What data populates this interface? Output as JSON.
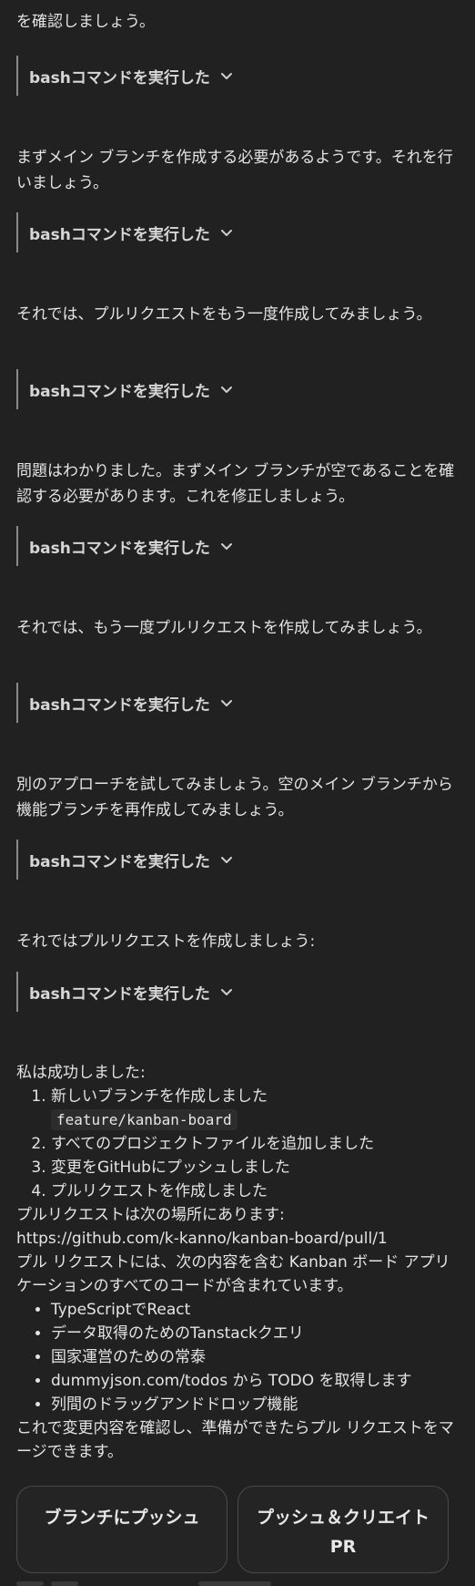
{
  "messages": {
    "top_fragment": "を確認しましょう。",
    "tool_label": "bashコマンドを実行した",
    "p1": "まずメイン ブランチを作成する必要があるようです。それを行いましょう。",
    "p2": "それでは、プルリクエストをもう一度作成してみましょう。",
    "p3": "問題はわかりました。まずメイン ブランチが空であることを確認する必要があります。これを修正しましょう。",
    "p4": "それでは、もう一度プルリクエストを作成してみましょう。",
    "p5": "別のアプローチを試してみましょう。空のメイン ブランチから機能ブランチを再作成してみましょう。",
    "p6": "それではプルリクエストを作成しましょう:"
  },
  "summary": {
    "intro": "私は成功しました:",
    "steps": [
      "新しいブランチを作成しました",
      "すべてのプロジェクトファイルを追加しました",
      "変更をGitHubにプッシュしました",
      "プルリクエストを作成しました"
    ],
    "branch_code": "feature/kanban-board",
    "pr_location": "プルリクエストは次の場所にあります:",
    "pr_url": "https://github.com/k-kanno/kanban-board/pull/1",
    "pr_contents": "プル リクエストには、次の内容を含む Kanban ボード アプリケーションのすべてのコードが含まれています。",
    "features": [
      "TypeScriptでReact",
      "データ取得のためのTanstackクエリ",
      "国家運営のための常泰",
      "dummyjson.com/todos から TODO を取得します",
      "列間のドラッグアンドドロップ機能"
    ],
    "closing": "これで変更内容を確認し、準備ができたらプル リクエストをマージできます。"
  },
  "actions": {
    "push_branch": "ブランチにプッシュ",
    "push_create_pr": "プッシュ＆クリエイトPR"
  },
  "icons": {
    "tool_chevron": "chevron-down-icon"
  },
  "colors": {
    "background": "#212121",
    "text": "#e4e4e4",
    "tool_border": "#8a8a8a",
    "button_border": "#4a4a4a"
  }
}
